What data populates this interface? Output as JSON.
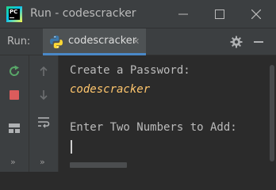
{
  "window": {
    "title": "Run - codescracker"
  },
  "run_panel": {
    "label": "Run:",
    "tab_label": "codescracker"
  },
  "console": {
    "lines": [
      "Create a Password:",
      "codescracker",
      "",
      "Enter Two Numbers to Add:"
    ]
  },
  "colors": {
    "background": "#2b2b2b",
    "panel": "#3c3f41",
    "text": "#bbbbbb",
    "user_input": "#ffc66d",
    "tab_underline": "#4a88c7",
    "rerun": "#59a869",
    "stop": "#db5c5c"
  },
  "icons": {
    "app": "pycharm-logo-icon",
    "tab": "python-icon",
    "settings": "gear-icon",
    "rerun": "rerun-icon",
    "stop": "stop-icon",
    "layout": "layout-icon",
    "scroll_up": "arrow-up-icon",
    "scroll_down": "arrow-down-icon",
    "soft_wrap": "soft-wrap-icon",
    "more": "more-chevron-icon"
  }
}
